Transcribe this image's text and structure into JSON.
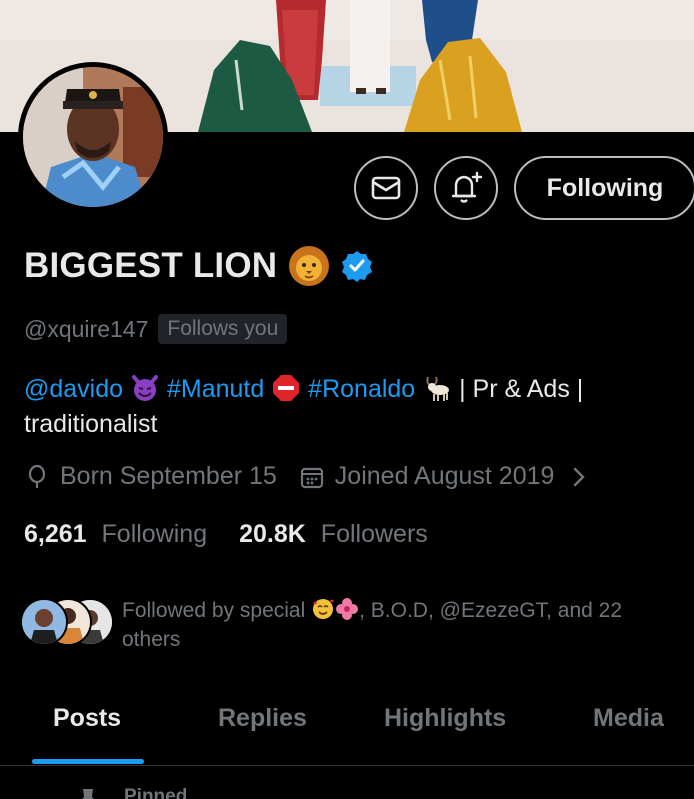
{
  "profile": {
    "display_name": "BIGGEST LION",
    "handle": "@xquire147",
    "follows_you_badge": "Follows you",
    "verified": true
  },
  "actions": {
    "message_icon": "envelope-icon",
    "notify_icon": "bell-plus-icon",
    "follow_state_label": "Following"
  },
  "bio": {
    "mention": "@davido",
    "hashtag_1": "#Manutd",
    "hashtag_2": "#Ronaldo",
    "tail": "| Pr & Ads |",
    "line2": "traditionalist"
  },
  "meta": {
    "birthday": "Born September 15",
    "joined": "Joined August 2019"
  },
  "stats": {
    "following_count": "6,261",
    "following_label": "Following",
    "followers_count": "20.8K",
    "followers_label": "Followers"
  },
  "followed_by": {
    "prefix": "Followed by special",
    "suffix": ", B.O.D, @EzezeGT, and 22 others"
  },
  "tabs": [
    {
      "label": "Posts",
      "active": true
    },
    {
      "label": "Replies",
      "active": false
    },
    {
      "label": "Highlights",
      "active": false
    },
    {
      "label": "Media",
      "active": false
    }
  ],
  "pinned": {
    "label": "Pinned"
  },
  "colors": {
    "background": "#000000",
    "text_primary": "#e7e9ea",
    "text_secondary": "#71767b",
    "accent": "#1d9bf0",
    "border": "#2f3336"
  }
}
